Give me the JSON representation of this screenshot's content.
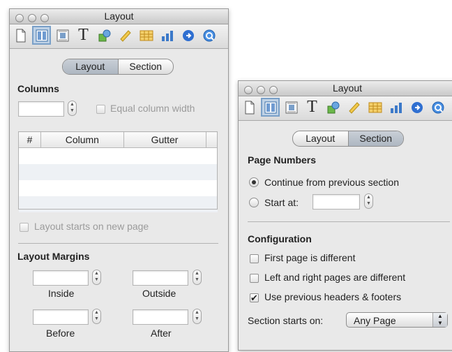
{
  "colors": {
    "selected_tab": "#aeb7c2",
    "selected_tool": "#7aa0c8"
  },
  "left_panel": {
    "title": "Layout",
    "tabs": [
      {
        "label": "Layout",
        "selected": true
      },
      {
        "label": "Section",
        "selected": false
      }
    ],
    "columns": {
      "heading": "Columns",
      "count_value": "",
      "equal_width_label": "Equal column width",
      "table_headers": [
        "#",
        "Column",
        "Gutter"
      ],
      "rows": 4
    },
    "layout_new_page_label": "Layout starts on new page",
    "margins": {
      "heading": "Layout Margins",
      "inside_label": "Inside",
      "outside_label": "Outside",
      "before_label": "Before",
      "after_label": "After"
    }
  },
  "right_panel": {
    "title": "Layout",
    "tabs": [
      {
        "label": "Layout",
        "selected": false
      },
      {
        "label": "Section",
        "selected": true
      }
    ],
    "page_numbers": {
      "heading": "Page Numbers",
      "continue_label": "Continue from previous section",
      "continue_selected": true,
      "start_at_label": "Start at:",
      "start_at_value": ""
    },
    "configuration": {
      "heading": "Configuration",
      "first_page_label": "First page is different",
      "first_page_checked": false,
      "left_right_label": "Left and right pages are different",
      "left_right_checked": false,
      "use_previous_label": "Use previous headers & footers",
      "use_previous_checked": true,
      "section_starts_label": "Section starts on:",
      "section_starts_value": "Any Page"
    }
  },
  "toolbar_icons": [
    "document-icon",
    "layout-icon",
    "wrap-icon",
    "text-icon",
    "graphic-icon",
    "metrics-icon",
    "table-icon",
    "chart-icon",
    "link-icon",
    "quicktime-icon"
  ]
}
